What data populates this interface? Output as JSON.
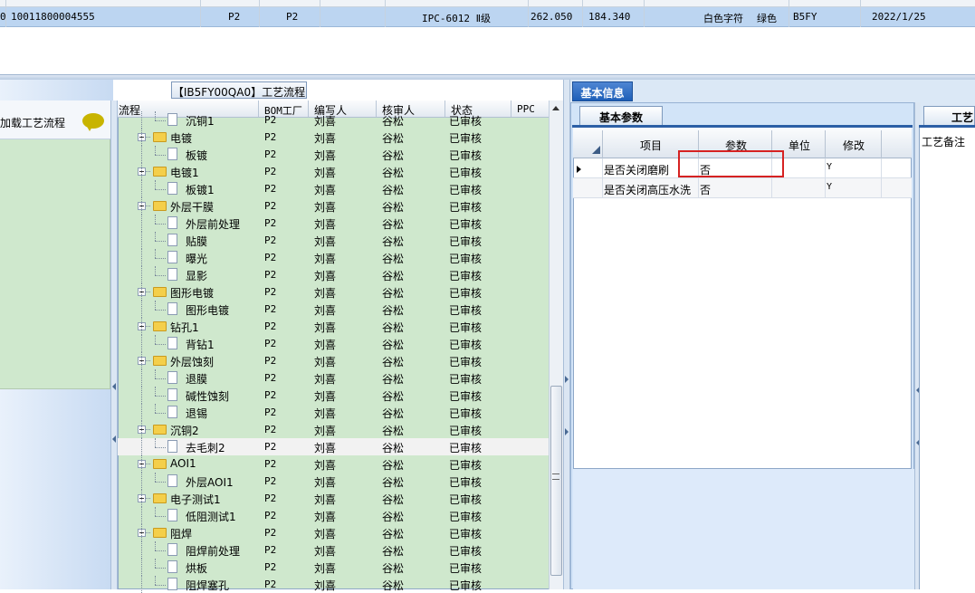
{
  "top_grid": {
    "row": {
      "mark": "0",
      "code": "10011800004555",
      "bom": "P2",
      "plant": "P2",
      "standard": "IPC-6012 Ⅱ级",
      "length": "262.050",
      "width": "184.340",
      "char_color": "白色字符",
      "mask_color": "绿色",
      "code2": "B5FY",
      "date": "2022/1/25"
    }
  },
  "left_panel": {
    "title": "加载工艺流程"
  },
  "tree_panel": {
    "title": "【IB5FY00QA0】工艺流程",
    "columns": [
      "流程",
      "BOM工厂",
      "编写人",
      "核审人",
      "状态",
      "PPC"
    ],
    "rows": [
      {
        "level": 2,
        "type": "doc",
        "name": "沉铜1",
        "bom": "P2",
        "writer": "刘喜",
        "reviewer": "谷松",
        "status": "已审核"
      },
      {
        "level": 1,
        "type": "folder",
        "name": "电镀",
        "bom": "P2",
        "writer": "刘喜",
        "reviewer": "谷松",
        "status": "已审核"
      },
      {
        "level": 2,
        "type": "doc",
        "name": "板镀",
        "bom": "P2",
        "writer": "刘喜",
        "reviewer": "谷松",
        "status": "已审核"
      },
      {
        "level": 1,
        "type": "folder",
        "name": "电镀1",
        "bom": "P2",
        "writer": "刘喜",
        "reviewer": "谷松",
        "status": "已审核"
      },
      {
        "level": 2,
        "type": "doc",
        "name": "板镀1",
        "bom": "P2",
        "writer": "刘喜",
        "reviewer": "谷松",
        "status": "已审核"
      },
      {
        "level": 1,
        "type": "folder",
        "name": "外层干膜",
        "bom": "P2",
        "writer": "刘喜",
        "reviewer": "谷松",
        "status": "已审核"
      },
      {
        "level": 2,
        "type": "doc",
        "name": "外层前处理",
        "bom": "P2",
        "writer": "刘喜",
        "reviewer": "谷松",
        "status": "已审核"
      },
      {
        "level": 2,
        "type": "doc",
        "name": "贴膜",
        "bom": "P2",
        "writer": "刘喜",
        "reviewer": "谷松",
        "status": "已审核"
      },
      {
        "level": 2,
        "type": "doc",
        "name": "曝光",
        "bom": "P2",
        "writer": "刘喜",
        "reviewer": "谷松",
        "status": "已审核"
      },
      {
        "level": 2,
        "type": "doc",
        "name": "显影",
        "bom": "P2",
        "writer": "刘喜",
        "reviewer": "谷松",
        "status": "已审核"
      },
      {
        "level": 1,
        "type": "folder",
        "name": "图形电镀",
        "bom": "P2",
        "writer": "刘喜",
        "reviewer": "谷松",
        "status": "已审核"
      },
      {
        "level": 2,
        "type": "doc",
        "name": "图形电镀",
        "bom": "P2",
        "writer": "刘喜",
        "reviewer": "谷松",
        "status": "已审核"
      },
      {
        "level": 1,
        "type": "folder",
        "name": "钻孔1",
        "bom": "P2",
        "writer": "刘喜",
        "reviewer": "谷松",
        "status": "已审核"
      },
      {
        "level": 2,
        "type": "doc",
        "name": "背钻1",
        "bom": "P2",
        "writer": "刘喜",
        "reviewer": "谷松",
        "status": "已审核"
      },
      {
        "level": 1,
        "type": "folder",
        "name": "外层蚀刻",
        "bom": "P2",
        "writer": "刘喜",
        "reviewer": "谷松",
        "status": "已审核"
      },
      {
        "level": 2,
        "type": "doc",
        "name": "退膜",
        "bom": "P2",
        "writer": "刘喜",
        "reviewer": "谷松",
        "status": "已审核"
      },
      {
        "level": 2,
        "type": "doc",
        "name": "碱性蚀刻",
        "bom": "P2",
        "writer": "刘喜",
        "reviewer": "谷松",
        "status": "已审核"
      },
      {
        "level": 2,
        "type": "doc",
        "name": "退锡",
        "bom": "P2",
        "writer": "刘喜",
        "reviewer": "谷松",
        "status": "已审核"
      },
      {
        "level": 1,
        "type": "folder",
        "name": "沉铜2",
        "bom": "P2",
        "writer": "刘喜",
        "reviewer": "谷松",
        "status": "已审核"
      },
      {
        "level": 2,
        "type": "doc",
        "name": "去毛刺2",
        "bom": "P2",
        "writer": "刘喜",
        "reviewer": "谷松",
        "status": "已审核",
        "selected": true
      },
      {
        "level": 1,
        "type": "folder",
        "name": "AOI1",
        "bom": "P2",
        "writer": "刘喜",
        "reviewer": "谷松",
        "status": "已审核"
      },
      {
        "level": 2,
        "type": "doc",
        "name": "外层AOI1",
        "bom": "P2",
        "writer": "刘喜",
        "reviewer": "谷松",
        "status": "已审核"
      },
      {
        "level": 1,
        "type": "folder",
        "name": "电子测试1",
        "bom": "P2",
        "writer": "刘喜",
        "reviewer": "谷松",
        "status": "已审核"
      },
      {
        "level": 2,
        "type": "doc",
        "name": "低阻测试1",
        "bom": "P2",
        "writer": "刘喜",
        "reviewer": "谷松",
        "status": "已审核"
      },
      {
        "level": 1,
        "type": "folder",
        "name": "阻焊",
        "bom": "P2",
        "writer": "刘喜",
        "reviewer": "谷松",
        "status": "已审核"
      },
      {
        "level": 2,
        "type": "doc",
        "name": "阻焊前处理",
        "bom": "P2",
        "writer": "刘喜",
        "reviewer": "谷松",
        "status": "已审核"
      },
      {
        "level": 2,
        "type": "doc",
        "name": "烘板",
        "bom": "P2",
        "writer": "刘喜",
        "reviewer": "谷松",
        "status": "已审核"
      },
      {
        "level": 2,
        "type": "doc",
        "name": "阻焊塞孔",
        "bom": "P2",
        "writer": "刘喜",
        "reviewer": "谷松",
        "status": "已审核"
      }
    ]
  },
  "right_panel": {
    "tab_label": "基本信息",
    "sub_tab_label": "基本参数",
    "param_columns": [
      "项目",
      "参数",
      "单位",
      "修改"
    ],
    "params": [
      {
        "item": "是否关闭磨刷",
        "value": "否",
        "unit": "",
        "modify": "Y"
      },
      {
        "item": "是否关闭高压水洗",
        "value": "否",
        "unit": "",
        "modify": "Y"
      }
    ]
  },
  "far_right": {
    "tab_label": "工艺",
    "note_label": "工艺备注"
  },
  "colors": {
    "tree_bg": "#cfe8cd",
    "selected_row": "#bcd5f1",
    "tab_active": "#1e5fb8",
    "highlight_box": "#d62222"
  }
}
